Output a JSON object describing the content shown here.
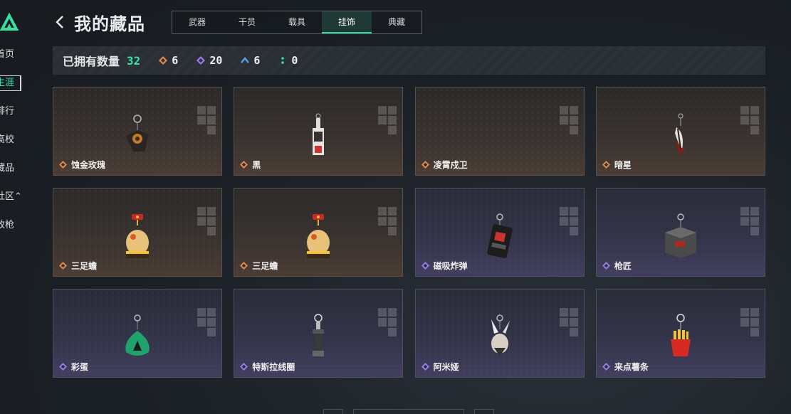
{
  "sidebar": {
    "items": [
      {
        "label": "首页",
        "active": false
      },
      {
        "label": "生涯",
        "active": true
      },
      {
        "label": "排行",
        "active": false
      },
      {
        "label": "高校",
        "active": false
      },
      {
        "label": "藏品",
        "active": false
      },
      {
        "label": "社区⌃",
        "active": false
      },
      {
        "label": "改枪",
        "active": false
      }
    ]
  },
  "header": {
    "title": "我的藏品",
    "tabs": [
      {
        "label": "武器",
        "active": false
      },
      {
        "label": "干员",
        "active": false
      },
      {
        "label": "载具",
        "active": false
      },
      {
        "label": "挂饰",
        "active": true
      },
      {
        "label": "典藏",
        "active": false
      }
    ]
  },
  "stats": {
    "label": "已拥有数量",
    "total": "32",
    "items": [
      {
        "icon": "orange-diamond-icon",
        "color": "#e08a4a",
        "value": "6"
      },
      {
        "icon": "purple-diamond-icon",
        "color": "#9a7be8",
        "value": "20"
      },
      {
        "icon": "blue-chevron-icon",
        "color": "#5b9be8",
        "value": "6"
      },
      {
        "icon": "green-dots-icon",
        "color": "#35e0a0",
        "value": "0"
      }
    ]
  },
  "cards": [
    {
      "name": "蚀金玫瑰",
      "rarity": "orange",
      "art": "rose-charm-icon"
    },
    {
      "name": "黑",
      "rarity": "orange",
      "art": "tag-charm-icon"
    },
    {
      "name": "凌霄戍卫",
      "rarity": "orange",
      "art": "empty-charm"
    },
    {
      "name": "暗星",
      "rarity": "orange",
      "art": "feather-charm-icon"
    },
    {
      "name": "三足蟾",
      "rarity": "orange",
      "art": "toad-charm-icon"
    },
    {
      "name": "三足蟾",
      "rarity": "orange",
      "art": "toad-charm-icon"
    },
    {
      "name": "磁吸炸弹",
      "rarity": "purple",
      "art": "bomb-charm-icon"
    },
    {
      "name": "枪匠",
      "rarity": "purple",
      "art": "case-charm-icon"
    },
    {
      "name": "彩蛋",
      "rarity": "purple",
      "art": "egg-charm-icon"
    },
    {
      "name": "特斯拉线圈",
      "rarity": "purple",
      "art": "coil-charm-icon"
    },
    {
      "name": "阿米娅",
      "rarity": "purple",
      "art": "bunny-charm-icon"
    },
    {
      "name": "来点薯条",
      "rarity": "purple",
      "art": "fries-charm-icon"
    }
  ],
  "colors": {
    "accent": "#35e0a0",
    "orange": "#e08a4a",
    "purple": "#9a7be8"
  }
}
